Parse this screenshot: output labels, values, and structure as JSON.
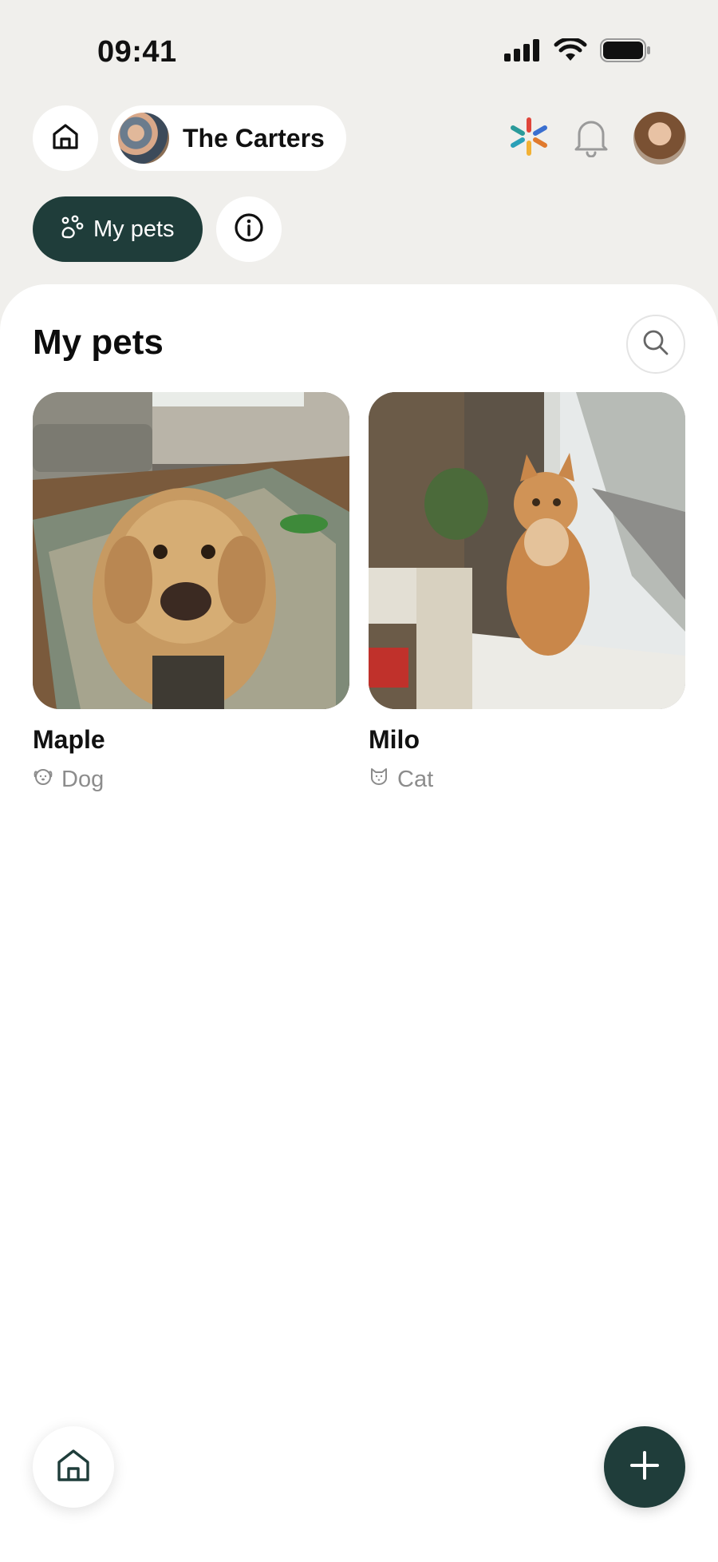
{
  "status_bar": {
    "time": "09:41",
    "icons": [
      "signal-icon",
      "wifi-icon",
      "battery-icon"
    ]
  },
  "header": {
    "home_icon": "home-icon",
    "family": {
      "name": "The Carters",
      "avatar": "family-avatar"
    },
    "right_icons": [
      "sparkle-icon",
      "bell-icon",
      "profile-avatar"
    ]
  },
  "segments": {
    "my_pets_label": "My pets",
    "my_pets_icon": "paw-icon",
    "info_icon": "info-icon"
  },
  "main": {
    "title": "My pets",
    "search_icon": "search-icon",
    "pets": [
      {
        "name": "Maple",
        "type": "Dog",
        "type_icon": "dog-face-icon"
      },
      {
        "name": "Milo",
        "type": "Cat",
        "type_icon": "cat-face-icon"
      }
    ]
  },
  "bottom": {
    "home_icon": "home-icon",
    "add_icon": "plus-icon"
  },
  "colors": {
    "accent": "#1f3d3a",
    "background": "#f0efec",
    "sheet": "#ffffff",
    "muted_text": "#8c8c8c"
  }
}
